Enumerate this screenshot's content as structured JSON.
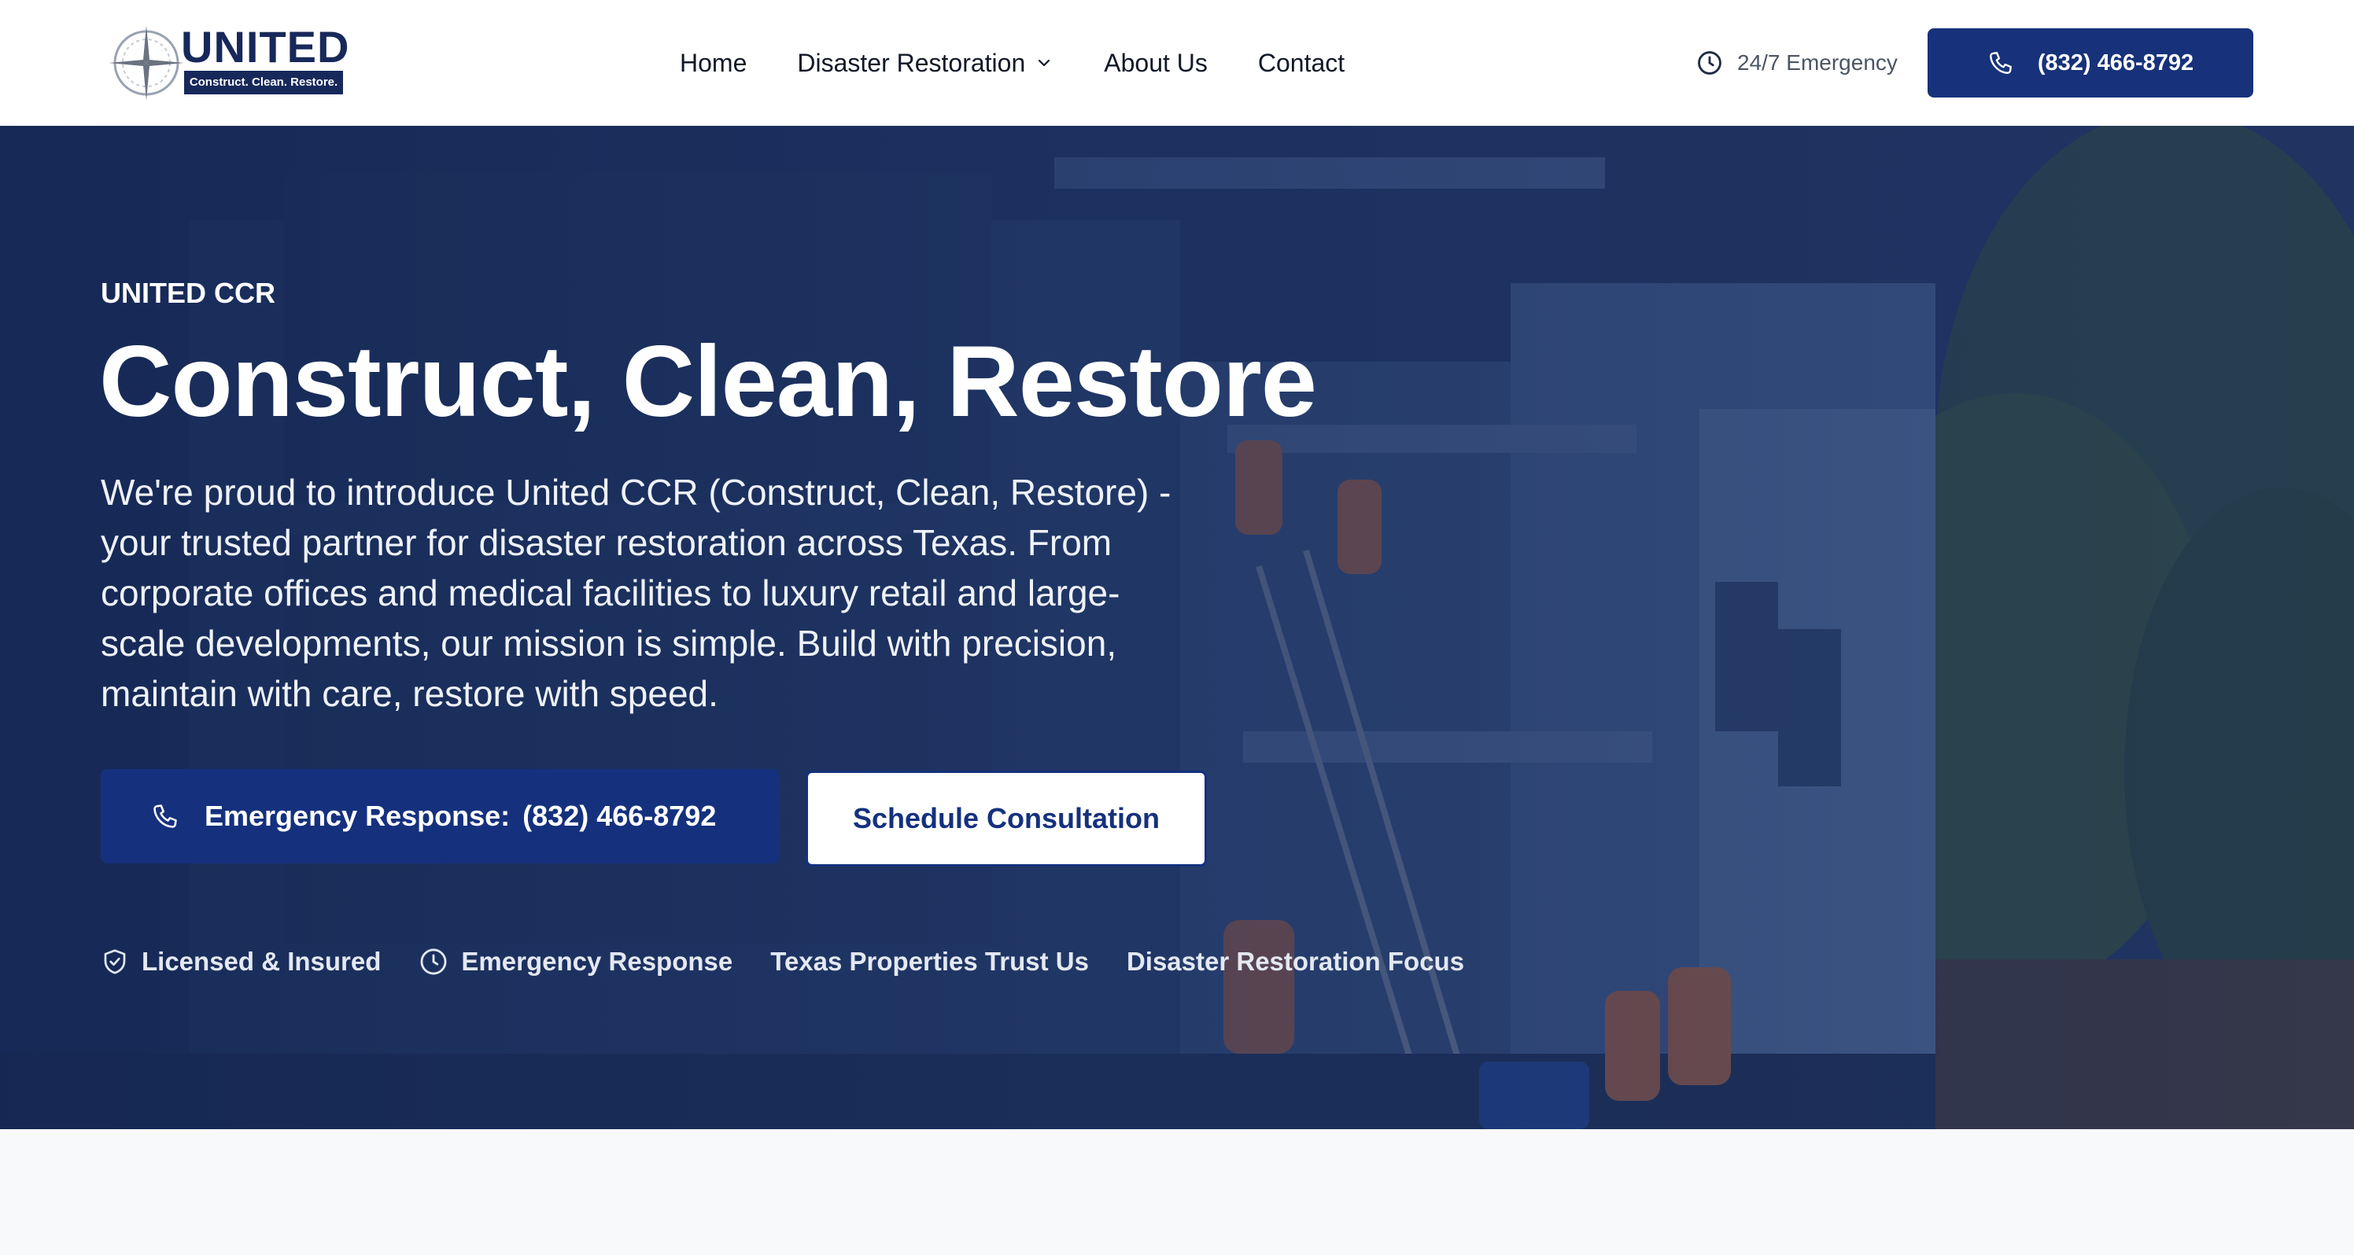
{
  "brand": {
    "wordmark": "UNITED",
    "tagline": "Construct. Clean. Restore."
  },
  "nav": {
    "items": [
      {
        "label": "Home"
      },
      {
        "label": "Disaster Restoration",
        "icon": "chevron-down-icon"
      },
      {
        "label": "About Us"
      },
      {
        "label": "Contact"
      }
    ]
  },
  "header_actions": {
    "emergency_label": "24/7 Emergency",
    "phone_label": "(832) 466-8792"
  },
  "hero": {
    "eyebrow": "UNITED CCR",
    "headline": "Construct, Clean, Restore",
    "lead": "We're proud to introduce United CCR (Construct, Clean, Restore) - your trusted partner for disaster restoration across Texas. From corporate offices and medical facilities to luxury retail and large-scale developments, our mission is simple. Build with precision, maintain with care, restore with speed.",
    "cta_primary_label": "Emergency Response:",
    "cta_primary_phone": "(832) 466-8792",
    "cta_secondary_label": "Schedule Consultation",
    "badges": [
      {
        "label": "Licensed & Insured",
        "icon": "shield-check-icon"
      },
      {
        "label": "Emergency Response",
        "icon": "clock-icon"
      },
      {
        "label": "Texas Properties Trust Us"
      },
      {
        "label": "Disaster Restoration Focus"
      }
    ]
  },
  "colors": {
    "brand_navy": "#17285a",
    "button_blue": "#17327a",
    "hero_overlay": "#1a2f66",
    "text_dark": "#111827"
  }
}
